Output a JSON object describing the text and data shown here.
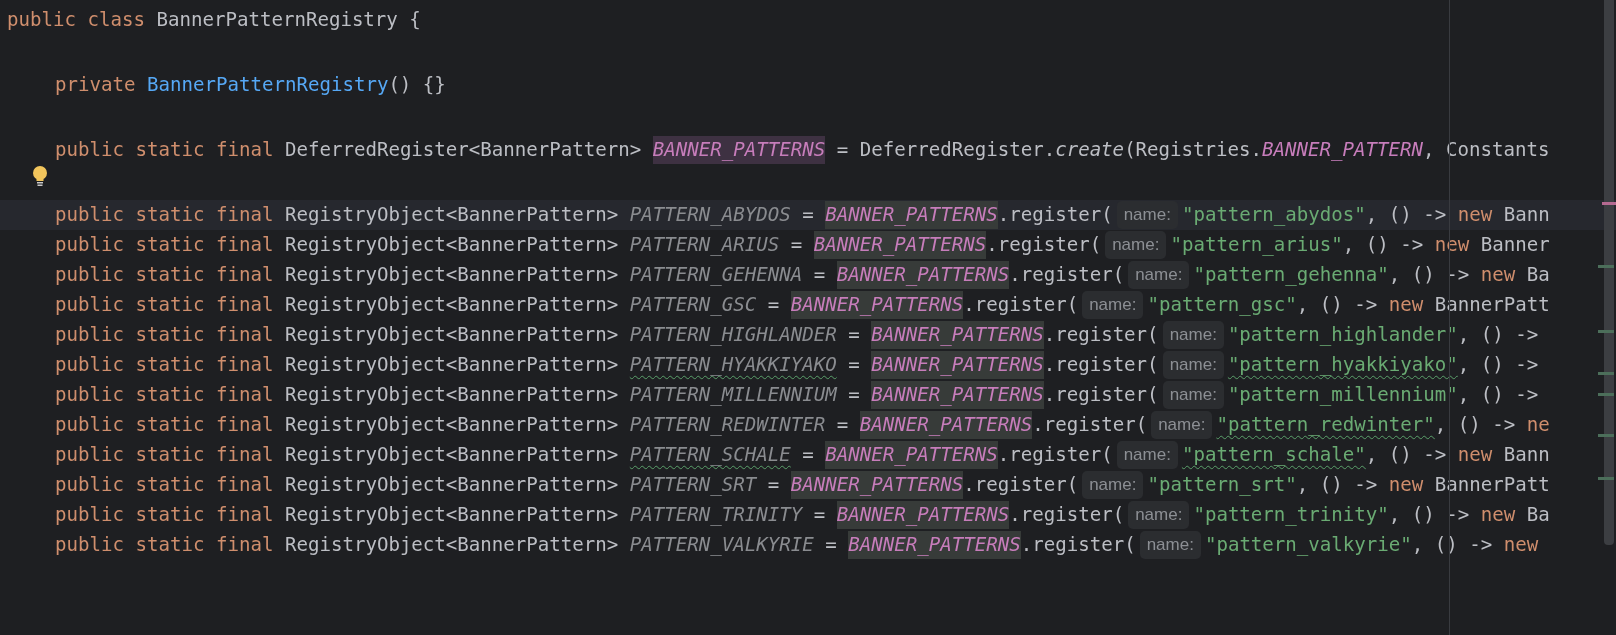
{
  "editor": {
    "lines": [
      {
        "kind": "top",
        "current": false,
        "tokens": [
          {
            "kind": "keyword",
            "text": "public class "
          },
          {
            "kind": "plain",
            "text": "BannerPatternRegistry {"
          }
        ]
      },
      {
        "kind": "blank",
        "current": false
      },
      {
        "kind": "code",
        "current": false,
        "tokens": [
          {
            "kind": "keyword",
            "text": "private "
          },
          {
            "kind": "method",
            "text": "BannerPatternRegistry"
          },
          {
            "kind": "plain",
            "text": "() {}"
          }
        ]
      },
      {
        "kind": "blank",
        "current": false
      },
      {
        "kind": "code",
        "current": false,
        "tokens": [
          {
            "kind": "keyword",
            "text": "public static final "
          },
          {
            "kind": "plain",
            "text": "DeferredRegister<BannerPattern> "
          },
          {
            "kind": "fielddecl",
            "text": "BANNER_PATTERNS"
          },
          {
            "kind": "plain",
            "text": " = DeferredRegister."
          },
          {
            "kind": "italic",
            "text": "create"
          },
          {
            "kind": "plain",
            "text": "(Registries."
          },
          {
            "kind": "field",
            "text": "BANNER_PATTERN"
          },
          {
            "kind": "plain",
            "text": ", Constants"
          }
        ]
      },
      {
        "kind": "bulb",
        "current": false
      },
      {
        "kind": "code",
        "current": true,
        "tokens": [
          {
            "kind": "keyword",
            "text": "public static final "
          },
          {
            "kind": "plain",
            "text": "RegistryObject<BannerPattern> "
          },
          {
            "kind": "constant",
            "text": "PATTERN_ABYDOS"
          },
          {
            "kind": "plain",
            "text": " = "
          },
          {
            "kind": "caret"
          },
          {
            "kind": "fieldusage",
            "text": "BANNER_PATTERNS"
          },
          {
            "kind": "plain",
            "text": ".register("
          },
          {
            "kind": "hint",
            "text": "name:"
          },
          {
            "kind": "string",
            "text": "\"pattern_abydos\""
          },
          {
            "kind": "plain",
            "text": ", () -> "
          },
          {
            "kind": "keyword",
            "text": "new "
          },
          {
            "kind": "plain",
            "text": "Bann"
          }
        ]
      },
      {
        "kind": "code",
        "current": false,
        "tokens": [
          {
            "kind": "keyword",
            "text": "public static final "
          },
          {
            "kind": "plain",
            "text": "RegistryObject<BannerPattern> "
          },
          {
            "kind": "constant",
            "text": "PATTERN_ARIUS"
          },
          {
            "kind": "plain",
            "text": " = "
          },
          {
            "kind": "fieldusage",
            "text": "BANNER_PATTERNS"
          },
          {
            "kind": "plain",
            "text": ".register("
          },
          {
            "kind": "hint",
            "text": "name:"
          },
          {
            "kind": "string",
            "text": "\"pattern_arius\""
          },
          {
            "kind": "plain",
            "text": ", () -> "
          },
          {
            "kind": "keyword",
            "text": "new "
          },
          {
            "kind": "plain",
            "text": "Banner"
          }
        ]
      },
      {
        "kind": "code",
        "current": false,
        "tokens": [
          {
            "kind": "keyword",
            "text": "public static final "
          },
          {
            "kind": "plain",
            "text": "RegistryObject<BannerPattern> "
          },
          {
            "kind": "constant",
            "text": "PATTERN_GEHENNA"
          },
          {
            "kind": "plain",
            "text": " = "
          },
          {
            "kind": "fieldusage",
            "text": "BANNER_PATTERNS"
          },
          {
            "kind": "plain",
            "text": ".register("
          },
          {
            "kind": "hint",
            "text": "name:"
          },
          {
            "kind": "string",
            "text": "\"pattern_gehenna\""
          },
          {
            "kind": "plain",
            "text": ", () -> "
          },
          {
            "kind": "keyword",
            "text": "new "
          },
          {
            "kind": "plain",
            "text": "Ba"
          }
        ]
      },
      {
        "kind": "code",
        "current": false,
        "tokens": [
          {
            "kind": "keyword",
            "text": "public static final "
          },
          {
            "kind": "plain",
            "text": "RegistryObject<BannerPattern> "
          },
          {
            "kind": "constant",
            "text": "PATTERN_GSC"
          },
          {
            "kind": "plain",
            "text": " = "
          },
          {
            "kind": "fieldusage",
            "text": "BANNER_PATTERNS"
          },
          {
            "kind": "plain",
            "text": ".register("
          },
          {
            "kind": "hint",
            "text": "name:"
          },
          {
            "kind": "string",
            "text": "\"pattern_gsc\""
          },
          {
            "kind": "plain",
            "text": ", () -> "
          },
          {
            "kind": "keyword",
            "text": "new "
          },
          {
            "kind": "plain",
            "text": "BannerPatt"
          }
        ]
      },
      {
        "kind": "code",
        "current": false,
        "tokens": [
          {
            "kind": "keyword",
            "text": "public static final "
          },
          {
            "kind": "plain",
            "text": "RegistryObject<BannerPattern> "
          },
          {
            "kind": "constant",
            "text": "PATTERN_HIGHLANDER"
          },
          {
            "kind": "plain",
            "text": " = "
          },
          {
            "kind": "fieldusage",
            "text": "BANNER_PATTERNS"
          },
          {
            "kind": "plain",
            "text": ".register("
          },
          {
            "kind": "hint",
            "text": "name:"
          },
          {
            "kind": "string",
            "text": "\"pattern_highlander\""
          },
          {
            "kind": "plain",
            "text": ", () ->"
          }
        ]
      },
      {
        "kind": "code",
        "current": false,
        "tokens": [
          {
            "kind": "keyword",
            "text": "public static final "
          },
          {
            "kind": "plain",
            "text": "RegistryObject<BannerPattern> "
          },
          {
            "kind": "constanttypo",
            "text": "PATTERN_HYAKKIYAKO"
          },
          {
            "kind": "plain",
            "text": " = "
          },
          {
            "kind": "fieldusage",
            "text": "BANNER_PATTERNS"
          },
          {
            "kind": "plain",
            "text": ".register("
          },
          {
            "kind": "hint",
            "text": "name:"
          },
          {
            "kind": "stringtypo",
            "text": "\"pattern_hyakkiyako\""
          },
          {
            "kind": "plain",
            "text": ", () ->"
          }
        ]
      },
      {
        "kind": "code",
        "current": false,
        "tokens": [
          {
            "kind": "keyword",
            "text": "public static final "
          },
          {
            "kind": "plain",
            "text": "RegistryObject<BannerPattern> "
          },
          {
            "kind": "constant",
            "text": "PATTERN_MILLENNIUM"
          },
          {
            "kind": "plain",
            "text": " = "
          },
          {
            "kind": "fieldusage",
            "text": "BANNER_PATTERNS"
          },
          {
            "kind": "plain",
            "text": ".register("
          },
          {
            "kind": "hint",
            "text": "name:"
          },
          {
            "kind": "string",
            "text": "\"pattern_millennium\""
          },
          {
            "kind": "plain",
            "text": ", () ->"
          }
        ]
      },
      {
        "kind": "code",
        "current": false,
        "tokens": [
          {
            "kind": "keyword",
            "text": "public static final "
          },
          {
            "kind": "plain",
            "text": "RegistryObject<BannerPattern> "
          },
          {
            "kind": "constant",
            "text": "PATTERN_REDWINTER"
          },
          {
            "kind": "plain",
            "text": " = "
          },
          {
            "kind": "fieldusage",
            "text": "BANNER_PATTERNS"
          },
          {
            "kind": "plain",
            "text": ".register("
          },
          {
            "kind": "hint",
            "text": "name:"
          },
          {
            "kind": "stringtypo",
            "text": "\"pattern_redwinter\""
          },
          {
            "kind": "plain",
            "text": ", () -> "
          },
          {
            "kind": "keyword",
            "text": "ne"
          }
        ]
      },
      {
        "kind": "code",
        "current": false,
        "tokens": [
          {
            "kind": "keyword",
            "text": "public static final "
          },
          {
            "kind": "plain",
            "text": "RegistryObject<BannerPattern> "
          },
          {
            "kind": "constanttypo",
            "text": "PATTERN_SCHALE"
          },
          {
            "kind": "plain",
            "text": " = "
          },
          {
            "kind": "fieldusage",
            "text": "BANNER_PATTERNS"
          },
          {
            "kind": "plain",
            "text": ".register("
          },
          {
            "kind": "hint",
            "text": "name:"
          },
          {
            "kind": "stringtypo",
            "text": "\"pattern_schale\""
          },
          {
            "kind": "plain",
            "text": ", () -> "
          },
          {
            "kind": "keyword",
            "text": "new "
          },
          {
            "kind": "plain",
            "text": "Bann"
          }
        ]
      },
      {
        "kind": "code",
        "current": false,
        "tokens": [
          {
            "kind": "keyword",
            "text": "public static final "
          },
          {
            "kind": "plain",
            "text": "RegistryObject<BannerPattern> "
          },
          {
            "kind": "constant",
            "text": "PATTERN_SRT"
          },
          {
            "kind": "plain",
            "text": " = "
          },
          {
            "kind": "fieldusage",
            "text": "BANNER_PATTERNS"
          },
          {
            "kind": "plain",
            "text": ".register("
          },
          {
            "kind": "hint",
            "text": "name:"
          },
          {
            "kind": "string",
            "text": "\"pattern_srt\""
          },
          {
            "kind": "plain",
            "text": ", () -> "
          },
          {
            "kind": "keyword",
            "text": "new "
          },
          {
            "kind": "plain",
            "text": "BannerPatt"
          }
        ]
      },
      {
        "kind": "code",
        "current": false,
        "tokens": [
          {
            "kind": "keyword",
            "text": "public static final "
          },
          {
            "kind": "plain",
            "text": "RegistryObject<BannerPattern> "
          },
          {
            "kind": "constant",
            "text": "PATTERN_TRINITY"
          },
          {
            "kind": "plain",
            "text": " = "
          },
          {
            "kind": "fieldusage",
            "text": "BANNER_PATTERNS"
          },
          {
            "kind": "plain",
            "text": ".register("
          },
          {
            "kind": "hint",
            "text": "name:"
          },
          {
            "kind": "string",
            "text": "\"pattern_trinity\""
          },
          {
            "kind": "plain",
            "text": ", () -> "
          },
          {
            "kind": "keyword",
            "text": "new "
          },
          {
            "kind": "plain",
            "text": "Ba"
          }
        ]
      },
      {
        "kind": "code",
        "current": false,
        "tokens": [
          {
            "kind": "keyword",
            "text": "public static final "
          },
          {
            "kind": "plain",
            "text": "RegistryObject<BannerPattern> "
          },
          {
            "kind": "constant",
            "text": "PATTERN_VALKYRIE"
          },
          {
            "kind": "plain",
            "text": " = "
          },
          {
            "kind": "fieldusage",
            "text": "BANNER_PATTERNS"
          },
          {
            "kind": "plain",
            "text": ".register("
          },
          {
            "kind": "hint",
            "text": "name:"
          },
          {
            "kind": "string",
            "text": "\"pattern_valkyrie\""
          },
          {
            "kind": "plain",
            "text": ", () -> "
          },
          {
            "kind": "keyword",
            "text": "new"
          }
        ]
      }
    ]
  }
}
